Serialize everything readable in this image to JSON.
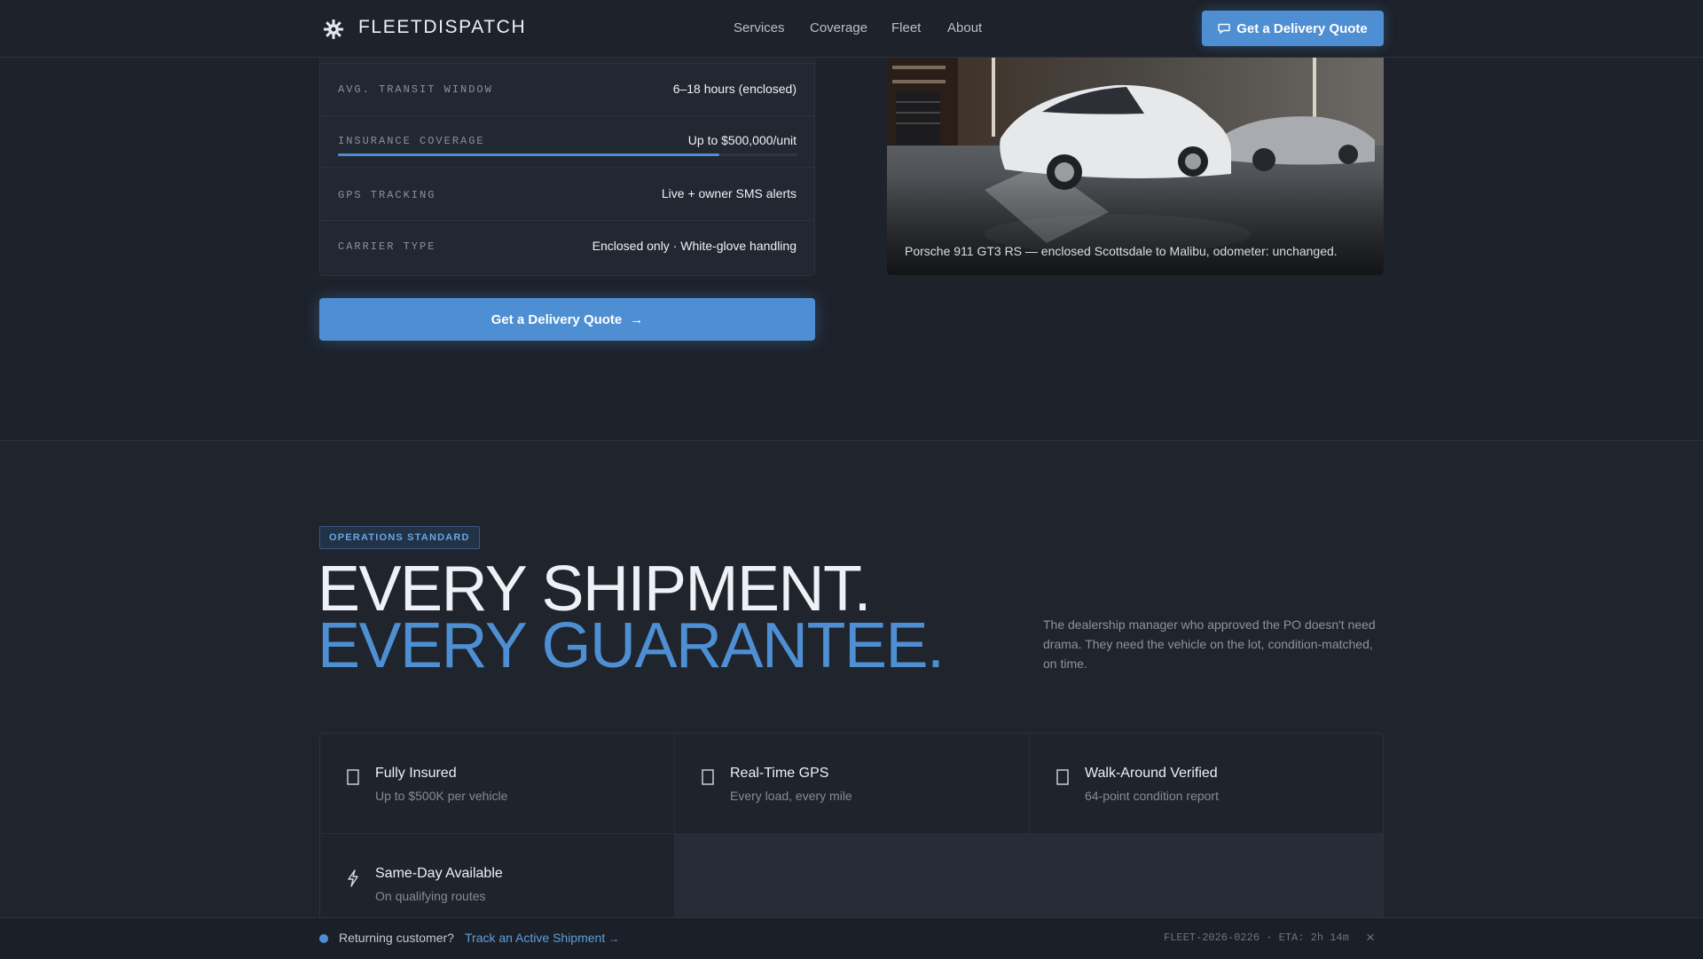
{
  "nav": {
    "brand": "FLEETDISPATCH",
    "links": [
      "Services",
      "Coverage",
      "Fleet",
      "About"
    ],
    "cta": "Get a Delivery Quote",
    "cta_icon": "chat-bubble-icon"
  },
  "specs": [
    {
      "label": "AVG. TRANSIT WINDOW",
      "value": "6–18 hours (enclosed)"
    },
    {
      "label": "INSURANCE COVERAGE",
      "value": "Up to $500,000/unit",
      "bar_fill_fraction": 0.83
    },
    {
      "label": "GPS TRACKING",
      "value": "Live + owner SMS alerts"
    },
    {
      "label": "CARRIER TYPE",
      "value": "Enclosed only · White-glove handling"
    }
  ],
  "main_cta": "Get a Delivery Quote",
  "photo": {
    "caption": "Porsche 911 GT3 RS — enclosed Scottsdale to Malibu, odometer: unchanged."
  },
  "section": {
    "eyebrow": "OPERATIONS STANDARD",
    "headline_1": "EVERY SHIPMENT.",
    "headline_2": "EVERY GUARANTEE.",
    "intro": "The dealership manager who approved the PO doesn't need drama. They need the vehicle on the lot, condition-matched, on time."
  },
  "features": [
    {
      "title": "Fully Insured",
      "subtitle": "Up to $500K per vehicle",
      "icon": "shield-icon"
    },
    {
      "title": "Real-Time GPS",
      "subtitle": "Every load, every mile",
      "icon": "gps-pin-icon"
    },
    {
      "title": "Walk-Around Verified",
      "subtitle": "64-point condition report",
      "icon": "checklist-icon"
    },
    {
      "title": "Same-Day Available",
      "subtitle": "On qualifying routes",
      "icon": "lightning-icon"
    }
  ],
  "bottom_bar": {
    "prompt": "Returning customer?",
    "link": "Track an Active Shipment",
    "shipment": "FLEET-2026-0226 · ETA: 2h 14m"
  },
  "colors": {
    "accent": "#4e8fd3",
    "background": "#1d222b"
  }
}
